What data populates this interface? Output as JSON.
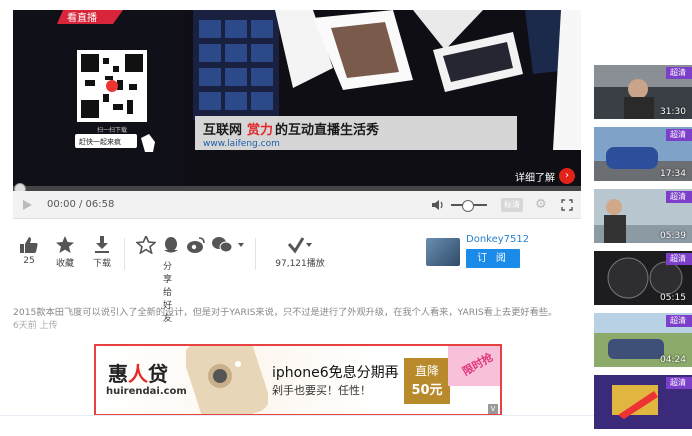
{
  "player": {
    "scene_caption": "互联网",
    "scene_caption_red": "赏力",
    "scene_caption_rest": "的互动直播生活秀",
    "scene_url": "www.laifeng.com",
    "scene_top_text": "看直播",
    "qr_label": "扫一扫下载",
    "qr_button": "赶快一起来疯",
    "learn_more": "详细了解",
    "learn_more_icon": "chevron-right-icon"
  },
  "controls": {
    "time": "00:00 / 06:58",
    "progress_fraction": 0.0,
    "volume_fraction": 0.45,
    "quality_label": "标清"
  },
  "actions": {
    "like_count": "25",
    "collect_label": "收藏",
    "download_label": "下载",
    "share_label": "分享给好友",
    "views": "97,121播放"
  },
  "uploader": {
    "name": "Donkey7512",
    "subscribe_label": "订 阅"
  },
  "description": "2015款本田飞度可以说引入了全新的设计，但是对于YARIS来说，只不过是进行了外观升级，在我个人看来，YARIS看上去更好看些。",
  "posted": "6天前 上传",
  "ad": {
    "logo_a": "惠",
    "logo_b": "人",
    "logo_c": "贷",
    "domain": "huirendai.com",
    "title": "iphone6免息分期再",
    "subtitle": "剁手也要买！任性！",
    "badge_line1": "直降",
    "badge_line2": "50元",
    "corner_label": "限时抢",
    "ad_mark": "V"
  },
  "sidebar": [
    {
      "tag": "超清",
      "duration": "31:30"
    },
    {
      "tag": "超清",
      "duration": "17:34"
    },
    {
      "tag": "超清",
      "duration": "05:39"
    },
    {
      "tag": "超清",
      "duration": "05:15"
    },
    {
      "tag": "超清",
      "duration": "04:24"
    },
    {
      "tag": "超清",
      "duration": ""
    }
  ],
  "colors": {
    "accent": "#1a8be8",
    "ad_border": "#e84141",
    "hd_tag": "#7c3fc9"
  }
}
